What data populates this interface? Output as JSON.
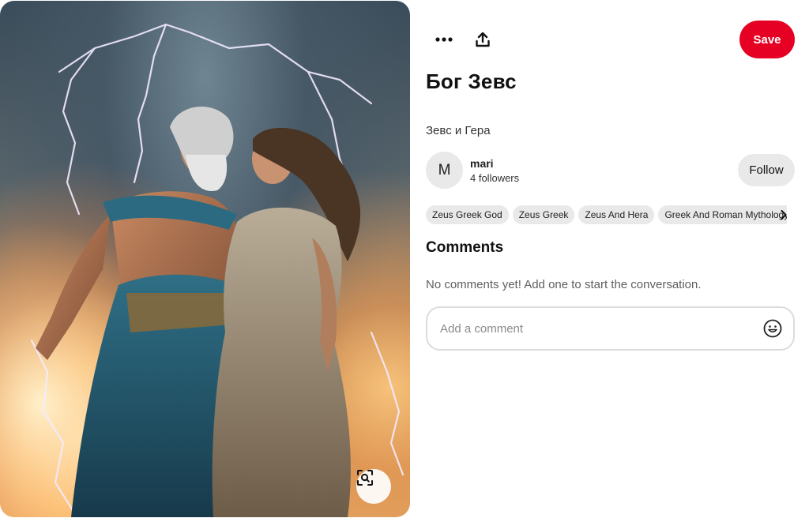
{
  "pin": {
    "title": "Бог Зевс",
    "description": "Зевс и Гера"
  },
  "actions": {
    "more_icon": "ellipsis-icon",
    "share_icon": "share-upload-icon",
    "save_label": "Save"
  },
  "author": {
    "avatar_letter": "M",
    "name": "mari",
    "followers": "4 followers",
    "follow_label": "Follow"
  },
  "tags": [
    "Zeus Greek God",
    "Zeus Greek",
    "Zeus And Hera",
    "Greek And Roman Mythology"
  ],
  "comments": {
    "heading": "Comments",
    "empty_text": "No comments yet! Add one to start the conversation.",
    "input_placeholder": "Add a comment",
    "emoji_icon": "smiley-icon"
  },
  "image": {
    "visual_search_icon": "visual-search-icon"
  },
  "colors": {
    "save_button": "#e60023",
    "chip_background": "#e9e9e9"
  }
}
